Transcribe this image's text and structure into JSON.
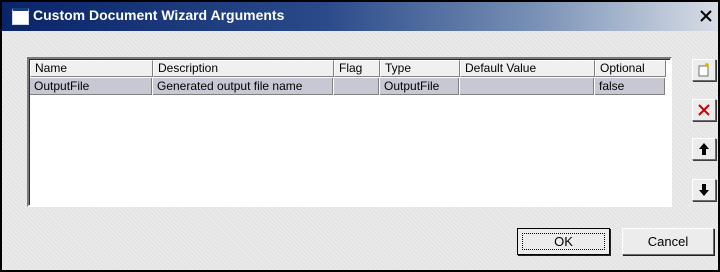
{
  "window": {
    "title": "Custom Document Wizard Arguments",
    "title_icon": "window-icon",
    "close_icon": "close-icon"
  },
  "grid": {
    "columns": [
      "Name",
      "Description",
      "Flag",
      "Type",
      "Default Value",
      "Optional"
    ],
    "rows": [
      [
        "OutputFile",
        "Generated output file name",
        "",
        "OutputFile",
        "",
        "false"
      ]
    ],
    "selected_row": 0
  },
  "side_buttons": [
    {
      "name": "new-argument-button",
      "icon": "new-item-icon"
    },
    {
      "name": "delete-argument-button",
      "icon": "delete-x-icon"
    },
    {
      "name": "move-up-button",
      "icon": "arrow-up-icon"
    },
    {
      "name": "move-down-button",
      "icon": "arrow-down-icon"
    }
  ],
  "buttons": {
    "ok_label": "OK",
    "cancel_label": "Cancel"
  },
  "colors": {
    "title_bar": "#0a246a",
    "selected_row": "#c8c8d4",
    "delete_icon": "#cc0000"
  }
}
